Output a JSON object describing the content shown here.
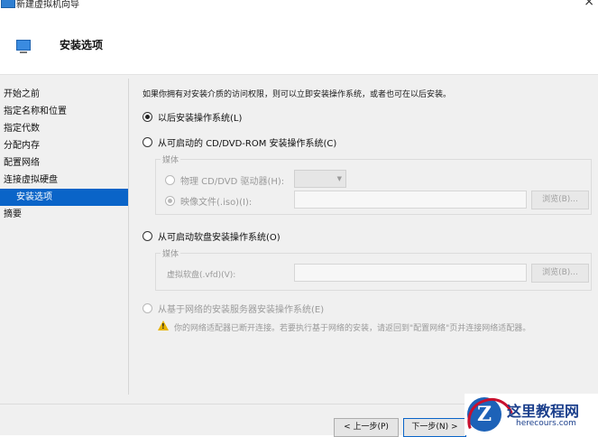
{
  "window": {
    "title": "新建虚拟机向导",
    "close_glyph": "×"
  },
  "header": {
    "title": "安装选项"
  },
  "sidebar": {
    "items": [
      {
        "label": "开始之前"
      },
      {
        "label": "指定名称和位置"
      },
      {
        "label": "指定代数"
      },
      {
        "label": "分配内存"
      },
      {
        "label": "配置网络"
      },
      {
        "label": "连接虚拟硬盘"
      },
      {
        "label": "安装选项"
      },
      {
        "label": "摘要"
      }
    ],
    "active_index": 6
  },
  "main": {
    "intro": "如果你拥有对安装介质的访问权限，则可以立即安装操作系统，或者也可在以后安装。",
    "options": {
      "later": {
        "label": "以后安装操作系统(L)",
        "selected": true
      },
      "cd_dvd": {
        "label": "从可启动的 CD/DVD-ROM 安装操作系统(C)",
        "selected": false,
        "group_label": "媒体",
        "physical_label": "物理 CD/DVD 驱动器(H):",
        "image_label": "映像文件(.iso)(I):",
        "browse_label": "浏览(B)..."
      },
      "floppy": {
        "label": "从可启动软盘安装操作系统(O)",
        "selected": false,
        "group_label": "媒体",
        "vfd_label": "虚拟软盘(.vfd)(V):",
        "browse_label": "浏览(B)..."
      },
      "network": {
        "label": "从基于网络的安装服务器安装操作系统(E)",
        "enabled": false,
        "warning": "你的网络适配器已断开连接。若要执行基于网络的安装，请返回到\"配置网络\"页并连接网络适配器。"
      }
    }
  },
  "footer": {
    "prev_label": "< 上一步(P)",
    "next_label": "下一步(N) >"
  },
  "watermark": {
    "logo_glyph": "Z",
    "title": "这里教程网",
    "subtitle": "herecours.com"
  },
  "colors": {
    "accent": "#0a64c8",
    "warning": "#e8b400",
    "watermark_red": "#c8102e",
    "watermark_blue": "#1b3f8c"
  }
}
